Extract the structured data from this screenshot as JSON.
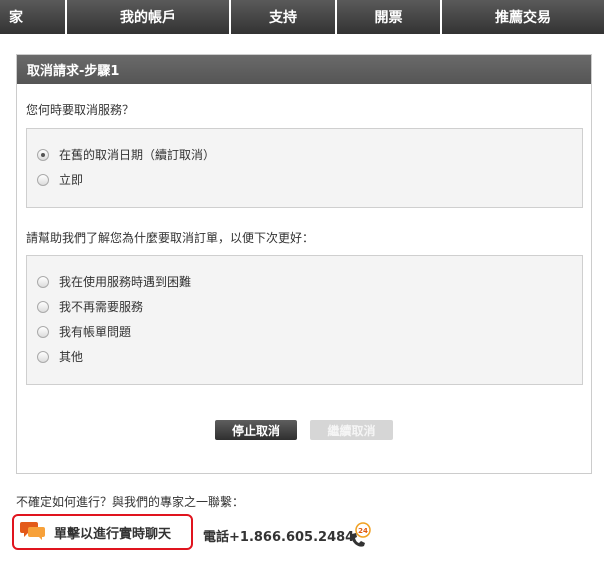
{
  "nav": {
    "items": [
      {
        "label": "家"
      },
      {
        "label": "我的帳戶"
      },
      {
        "label": "支持"
      },
      {
        "label": "開票"
      },
      {
        "label": "推薦交易"
      }
    ]
  },
  "panel": {
    "title": "取消請求-步驟1",
    "question1": "您何時要取消服務？",
    "timing_options": [
      {
        "label": "在舊的取消日期（續訂取消）",
        "selected": true
      },
      {
        "label": "立即",
        "selected": false
      }
    ],
    "question2": "請幫助我們了解您為什麼要取消訂單，以便下次更好：",
    "reason_options": [
      {
        "label": "我在使用服務時遇到困難",
        "selected": false
      },
      {
        "label": "我不再需要服務",
        "selected": false
      },
      {
        "label": "我有帳單問題",
        "selected": false
      },
      {
        "label": "其他",
        "selected": false
      }
    ],
    "stop_button": "停止取消",
    "continue_button": "繼續取消"
  },
  "footer": {
    "prompt": "不確定如何進行？與我們的專家之一聯繫：",
    "chat_label": "單擊以進行實時聊天",
    "phone_label": "電話+1.866.605.2484",
    "chat_icon": "chat-bubbles-icon",
    "phone_icon": "phone-24h-icon"
  },
  "colors": {
    "nav_bg": "#3a3a3a",
    "panel_header_bg": "#5f5f5f",
    "chat_border": "#e0141e",
    "chat_icon": "#f07d1f"
  }
}
